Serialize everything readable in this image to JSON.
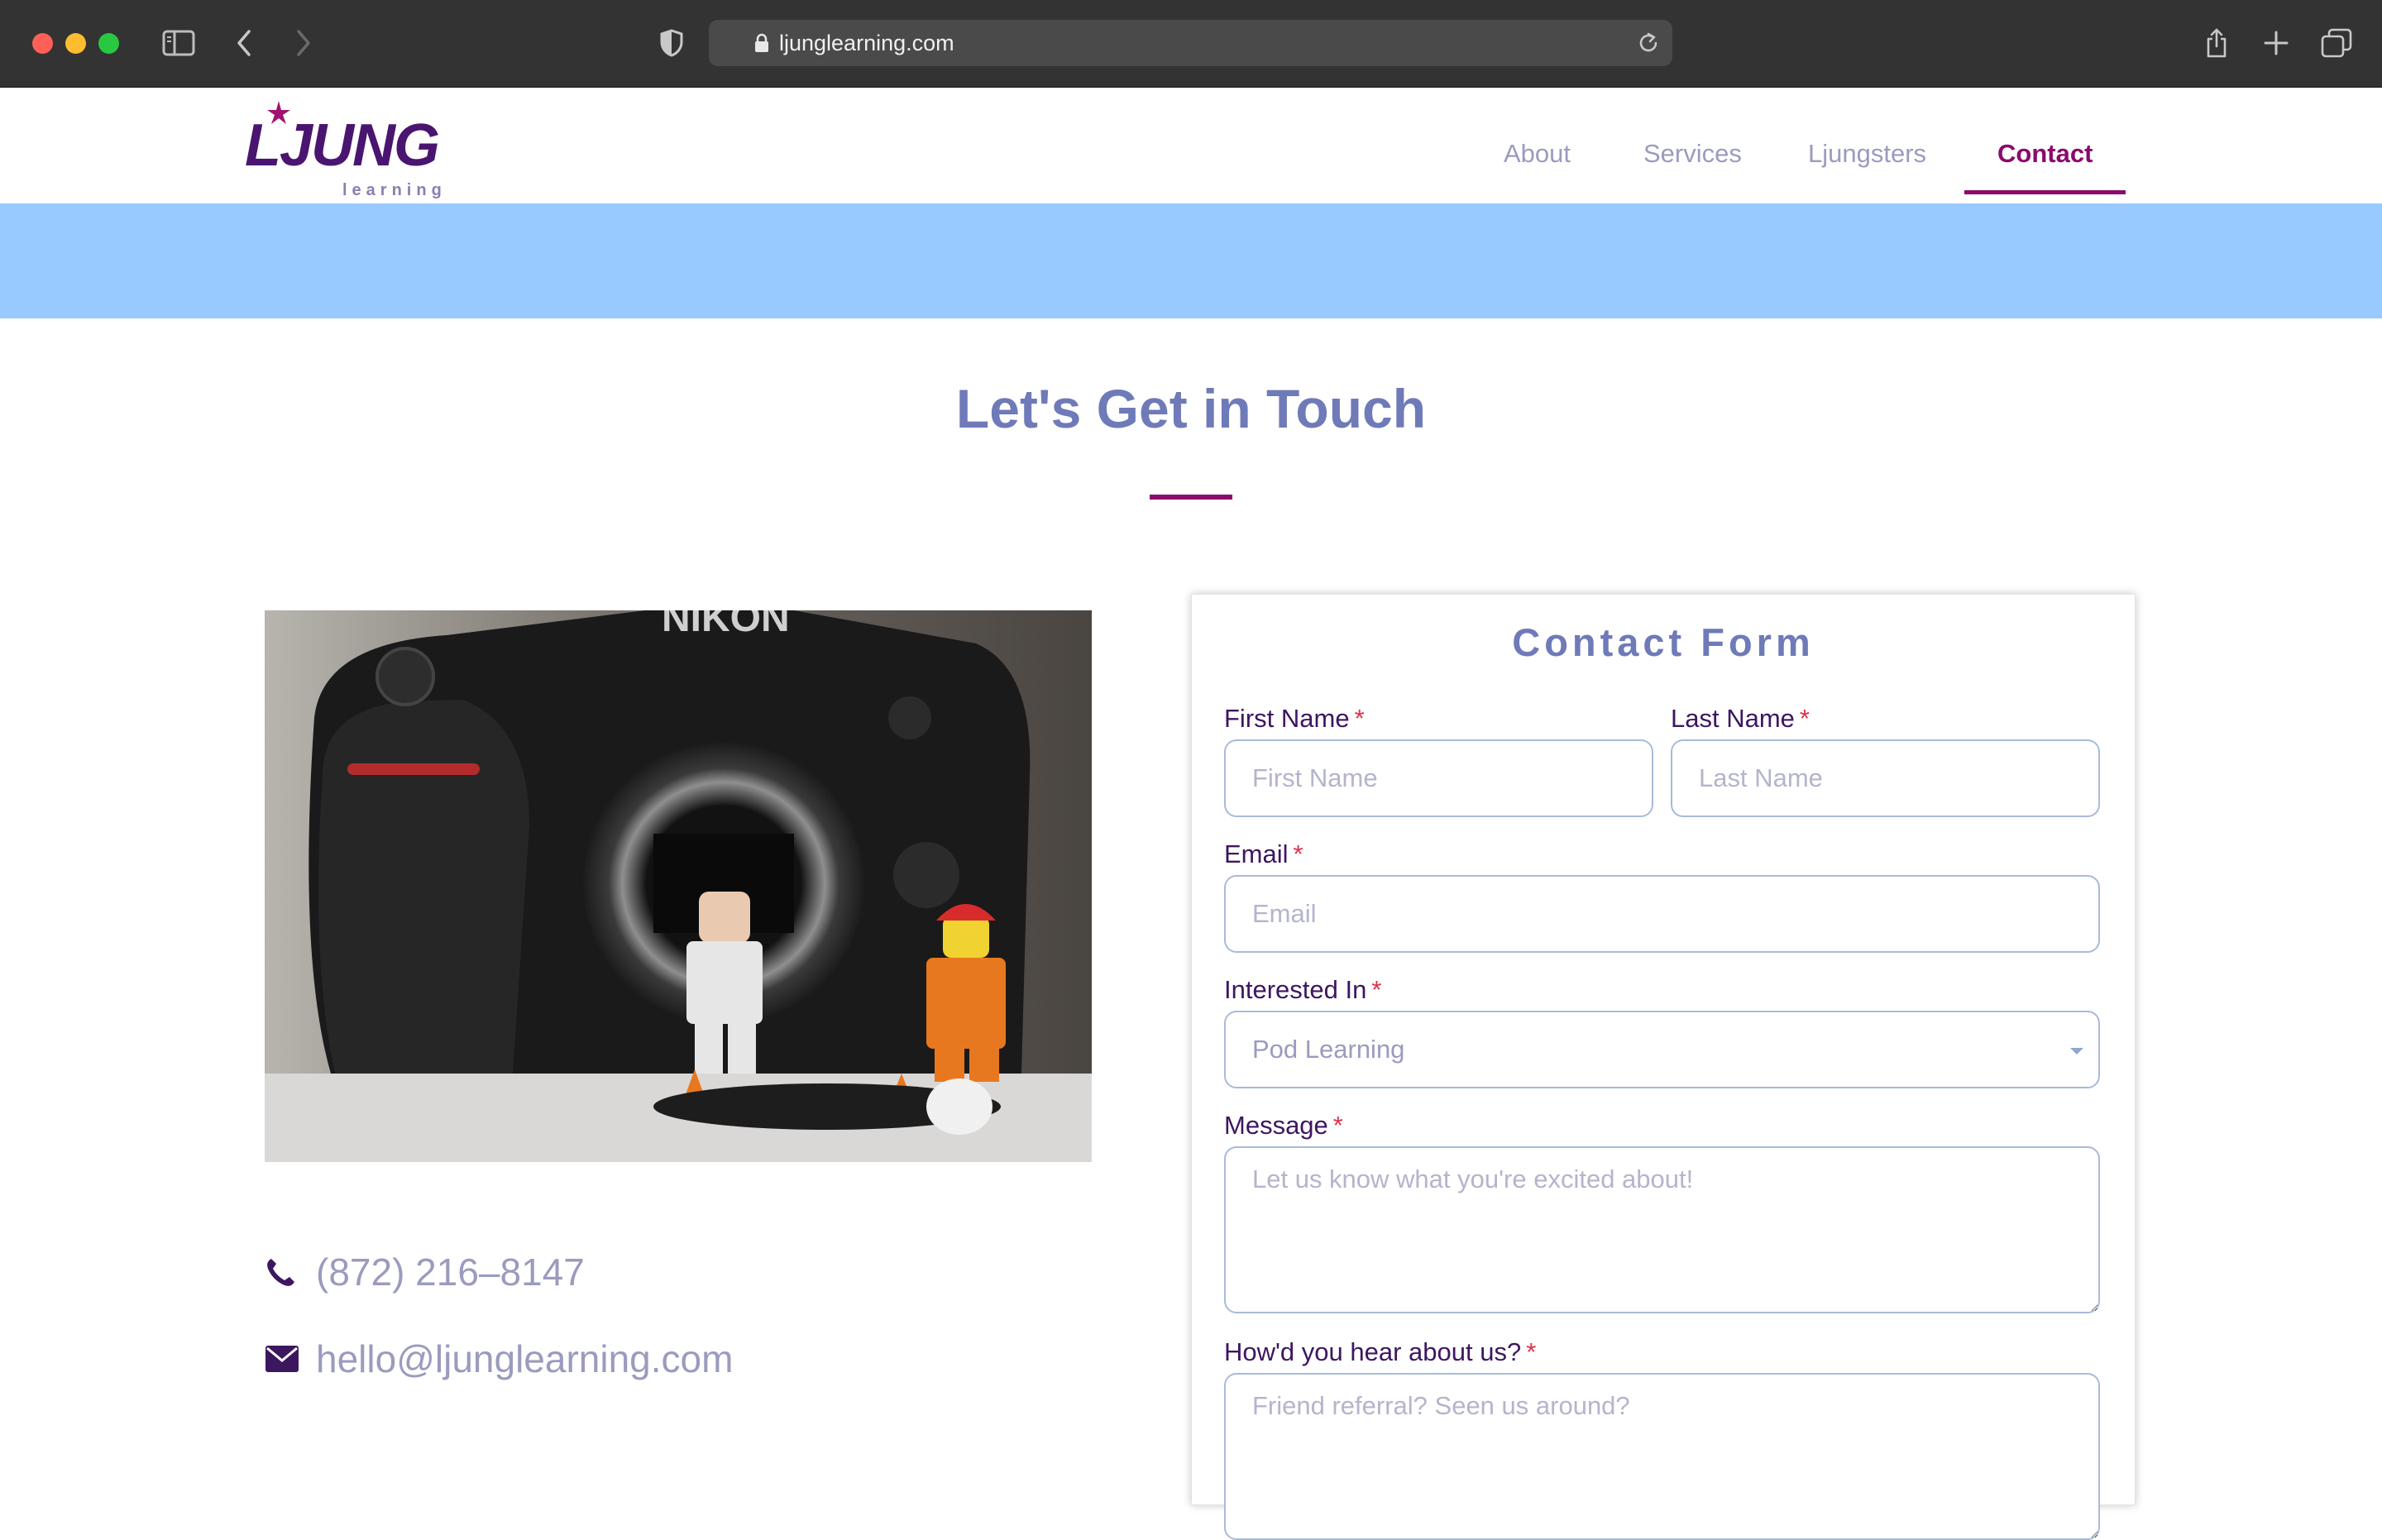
{
  "browser": {
    "url": "ljunglearning.com",
    "icons": {
      "sidebar": "sidebar-icon",
      "back": "chevron-left-icon",
      "forward": "chevron-right-icon",
      "privacy": "shield-icon",
      "lock": "lock-icon",
      "reload": "reload-icon",
      "share": "share-icon",
      "new_tab": "plus-icon",
      "tabs": "tab-overview-icon"
    }
  },
  "site": {
    "logo": {
      "word": "LJUNG",
      "sub": "learning"
    },
    "nav": [
      {
        "label": "About"
      },
      {
        "label": "Services"
      },
      {
        "label": "Ljungsters"
      },
      {
        "label": "Contact",
        "active": true
      }
    ],
    "colors": {
      "accent": "#8b0a6c",
      "title": "#6f7ab8",
      "banner": "#99caff",
      "label": "#3d1660"
    }
  },
  "main": {
    "title": "Let's Get in Touch",
    "phone": "(872) 216–8147",
    "email": "hello@ljunglearning.com"
  },
  "form": {
    "title": "Contact Form",
    "first_name": {
      "label": "First Name",
      "required": "*",
      "placeholder": "First Name",
      "value": ""
    },
    "last_name": {
      "label": "Last Name",
      "required": "*",
      "placeholder": "Last Name",
      "value": ""
    },
    "email": {
      "label": "Email",
      "required": "*",
      "placeholder": "Email",
      "value": ""
    },
    "interested_in": {
      "label": "Interested In",
      "required": "*",
      "selected": "Pod Learning"
    },
    "message": {
      "label": "Message",
      "required": "*",
      "placeholder": "Let us know what you're excited about!"
    },
    "referral": {
      "label": "How'd you hear about us?",
      "required": "*",
      "placeholder": "Friend referral? Seen us around?"
    }
  }
}
